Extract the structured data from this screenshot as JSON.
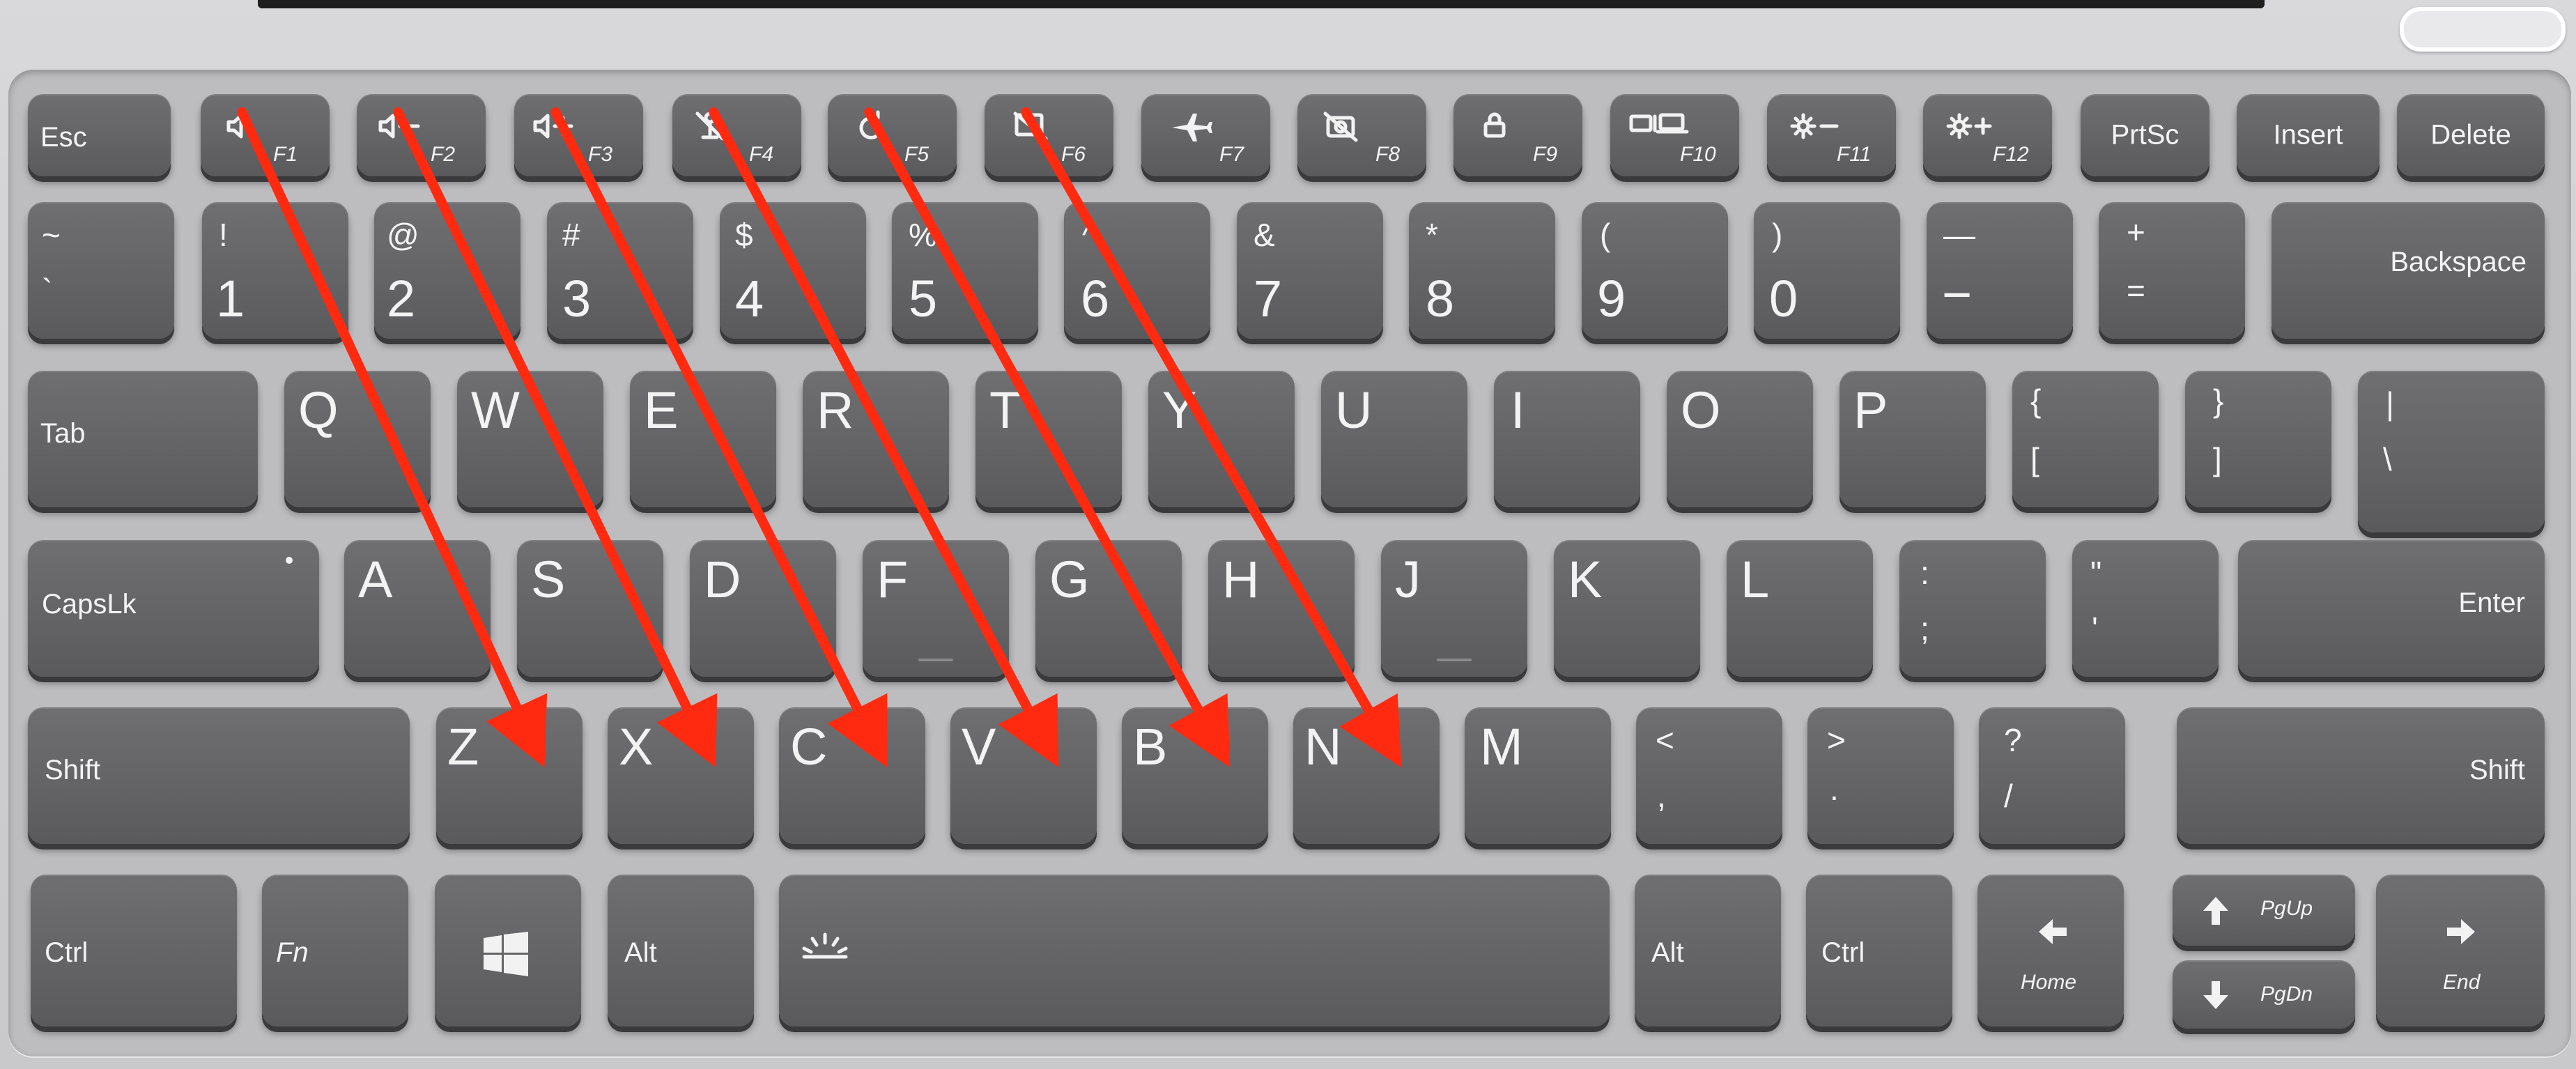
{
  "keyboard": {
    "function_row": [
      {
        "id": "esc",
        "label": "Esc"
      },
      {
        "id": "f1",
        "icon": "speaker-mute-icon",
        "sub": "F1"
      },
      {
        "id": "f2",
        "icon": "volume-down-icon",
        "sub": "F2"
      },
      {
        "id": "f3",
        "icon": "volume-up-icon",
        "sub": "F3"
      },
      {
        "id": "f4",
        "icon": "mic-mute-icon",
        "sub": "F4"
      },
      {
        "id": "f5",
        "icon": "refresh-icon",
        "sub": "F5"
      },
      {
        "id": "f6",
        "icon": "touchpad-off-icon",
        "sub": "F6"
      },
      {
        "id": "f7",
        "icon": "airplane-icon",
        "sub": "F7"
      },
      {
        "id": "f8",
        "icon": "camera-off-icon",
        "sub": "F8"
      },
      {
        "id": "f9",
        "icon": "lock-icon",
        "sub": "F9"
      },
      {
        "id": "f10",
        "icon": "display-switch-icon",
        "sub": "F10"
      },
      {
        "id": "f11",
        "icon": "brightness-down-icon",
        "sub": "F11"
      },
      {
        "id": "f12",
        "icon": "brightness-up-icon",
        "sub": "F12"
      },
      {
        "id": "prtsc",
        "label": "PrtSc"
      },
      {
        "id": "insert",
        "label": "Insert"
      },
      {
        "id": "delete",
        "label": "Delete"
      }
    ],
    "number_row": [
      {
        "id": "grave",
        "top": "~",
        "bottom": "`"
      },
      {
        "id": "1",
        "top": "!",
        "bottom": "1"
      },
      {
        "id": "2",
        "top": "@",
        "bottom": "2"
      },
      {
        "id": "3",
        "top": "#",
        "bottom": "3"
      },
      {
        "id": "4",
        "top": "$",
        "bottom": "4"
      },
      {
        "id": "5",
        "top": "%",
        "bottom": "5"
      },
      {
        "id": "6",
        "top": "^",
        "bottom": "6"
      },
      {
        "id": "7",
        "top": "&",
        "bottom": "7"
      },
      {
        "id": "8",
        "top": "*",
        "bottom": "8"
      },
      {
        "id": "9",
        "top": "(",
        "bottom": "9"
      },
      {
        "id": "0",
        "top": ")",
        "bottom": "0"
      },
      {
        "id": "minus",
        "top": "—",
        "bottom": "−"
      },
      {
        "id": "equals",
        "top": "+",
        "bottom": "="
      },
      {
        "id": "backspace",
        "label": "Backspace"
      }
    ],
    "qwerty_row": [
      {
        "id": "tab",
        "label": "Tab"
      },
      {
        "id": "q",
        "label": "Q"
      },
      {
        "id": "w",
        "label": "W"
      },
      {
        "id": "e",
        "label": "E"
      },
      {
        "id": "r",
        "label": "R"
      },
      {
        "id": "t",
        "label": "T"
      },
      {
        "id": "y",
        "label": "Y"
      },
      {
        "id": "u",
        "label": "U"
      },
      {
        "id": "i",
        "label": "I"
      },
      {
        "id": "o",
        "label": "O"
      },
      {
        "id": "p",
        "label": "P"
      },
      {
        "id": "lbracket",
        "top": "{",
        "bottom": "["
      },
      {
        "id": "rbracket",
        "top": "}",
        "bottom": "]"
      },
      {
        "id": "backslash",
        "top": "|",
        "bottom": "\\"
      }
    ],
    "home_row": [
      {
        "id": "capslock",
        "label": "CapsLk"
      },
      {
        "id": "a",
        "label": "A"
      },
      {
        "id": "s",
        "label": "S"
      },
      {
        "id": "d",
        "label": "D"
      },
      {
        "id": "f",
        "label": "F"
      },
      {
        "id": "g",
        "label": "G"
      },
      {
        "id": "h",
        "label": "H"
      },
      {
        "id": "j",
        "label": "J"
      },
      {
        "id": "k",
        "label": "K"
      },
      {
        "id": "l",
        "label": "L"
      },
      {
        "id": "semicolon",
        "top": ":",
        "bottom": ";"
      },
      {
        "id": "quote",
        "top": "\"",
        "bottom": "'"
      },
      {
        "id": "enter",
        "label": "Enter"
      }
    ],
    "shift_row": [
      {
        "id": "lshift",
        "label": "Shift"
      },
      {
        "id": "z",
        "label": "Z"
      },
      {
        "id": "x",
        "label": "X"
      },
      {
        "id": "c",
        "label": "C"
      },
      {
        "id": "v",
        "label": "V"
      },
      {
        "id": "b",
        "label": "B"
      },
      {
        "id": "n",
        "label": "N"
      },
      {
        "id": "m",
        "label": "M"
      },
      {
        "id": "comma",
        "top": "<",
        "bottom": ","
      },
      {
        "id": "period",
        "top": ">",
        "bottom": "."
      },
      {
        "id": "slash",
        "top": "?",
        "bottom": "/"
      },
      {
        "id": "rshift",
        "label": "Shift"
      }
    ],
    "bottom_row": [
      {
        "id": "lctrl",
        "label": "Ctrl"
      },
      {
        "id": "fnkey",
        "label": "Fn"
      },
      {
        "id": "win",
        "icon": "windows-logo-icon"
      },
      {
        "id": "lalt",
        "label": "Alt"
      },
      {
        "id": "space",
        "icon": "backlight-icon"
      },
      {
        "id": "ralt",
        "label": "Alt"
      },
      {
        "id": "rctrl",
        "label": "Ctrl"
      },
      {
        "id": "home",
        "icon": "arrow-left-icon",
        "sub": "Home"
      },
      {
        "id": "pgup",
        "icon": "arrow-up-icon",
        "sub": "PgUp"
      },
      {
        "id": "pgdn",
        "icon": "arrow-down-icon",
        "sub": "PgDn"
      },
      {
        "id": "end",
        "icon": "arrow-right-icon",
        "sub": "End"
      }
    ]
  },
  "annotations": {
    "arrow_color": "#ff2a10",
    "arrows": [
      {
        "from": "f1",
        "to": "z"
      },
      {
        "from": "f2",
        "to": "x"
      },
      {
        "from": "f3",
        "to": "c"
      },
      {
        "from": "f4",
        "to": "v"
      },
      {
        "from": "f5",
        "to": "b"
      },
      {
        "from": "f6",
        "to": "n"
      }
    ]
  }
}
